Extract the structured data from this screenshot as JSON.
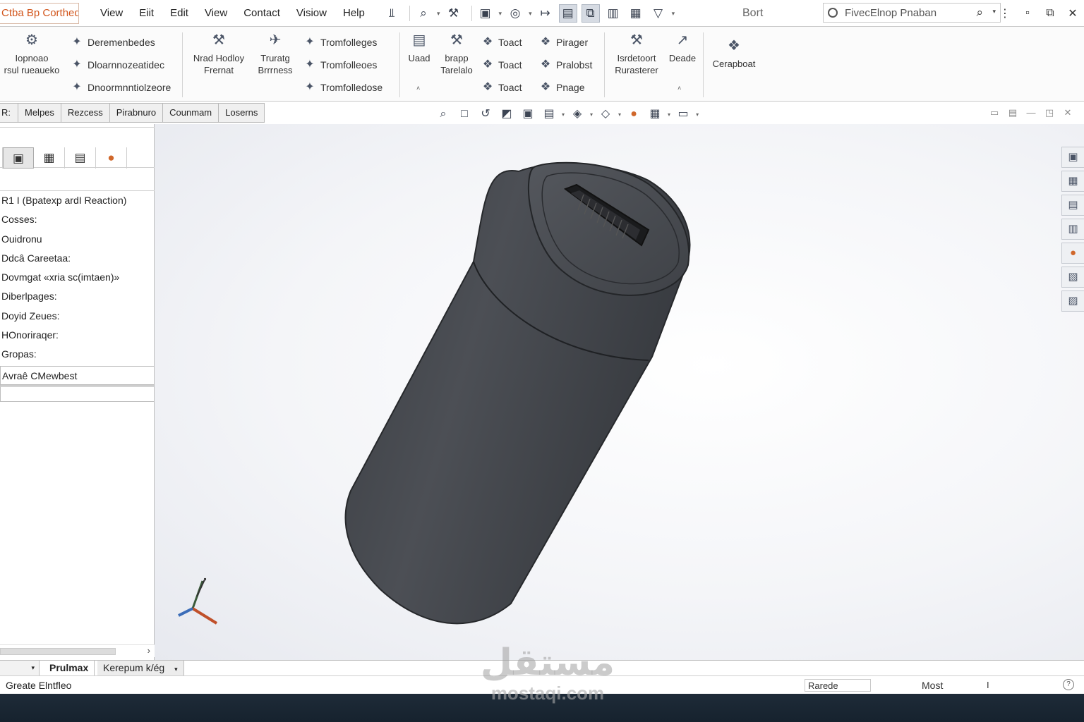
{
  "app": {
    "title": "Ctba Bp Corthed I",
    "document_name": "Bort"
  },
  "menu": {
    "items": [
      "View",
      "Eiit",
      "Edit",
      "View",
      "Contact",
      "Visiow",
      "Help"
    ]
  },
  "search": {
    "value": "FivecElnop Pnaban"
  },
  "ribbon": {
    "group1": {
      "big_label": "Iopnoao\nrsul rueaueko",
      "small": [
        "Deremenbedes",
        "Dloarnnozeatidec",
        "Dnoormnntiolzeore"
      ]
    },
    "group2": {
      "big": [
        "Nrad Hodloy\nFrernat",
        "Truratg\nBrrrness"
      ],
      "small": [
        "Tromfolleges",
        "Tromfolleoes",
        "Tromfolledose"
      ]
    },
    "group3": {
      "big": [
        "Uaad",
        "brapp\nTarelalo"
      ],
      "small_col1": [
        "Toact",
        "Toact",
        "Toact"
      ],
      "small_col2": [
        "Pirager",
        "Pralobst",
        "Pnage"
      ]
    },
    "group4": {
      "big": [
        "Isrdetoort\nRurasterer",
        "Deade"
      ]
    },
    "group5": {
      "big": [
        "Cerapboat"
      ]
    }
  },
  "command_tabs": [
    "R:",
    "Melpes",
    "Rezcess",
    "Pirabnuro",
    "Counmam",
    "Loserns"
  ],
  "left_panel": {
    "tree_items": [
      "R1 I (Bpatexp ardI Reaction)",
      "Cosses:",
      "Ouidronu",
      "Ddcâ Careetaa:",
      "Dovmgat «xria sc(imtaen)»",
      "Diberlpages:",
      "Doyid Zeues:",
      "HOnoriraqer:",
      "Gropas:",
      "Avraê CMewbest"
    ]
  },
  "bottom_tabs": [
    "Prulmax",
    "Kerepum k/ég"
  ],
  "status": {
    "text": "Greate Elntfleo",
    "box": "Rarede",
    "right": "Most",
    "marker": "I"
  },
  "watermark": {
    "arabic": "مستقل",
    "latin": "mostaqi.com"
  },
  "colors": {
    "title_orange": "#d2561c",
    "model_body": "#4a4d52",
    "footer": "#1e2b38"
  }
}
